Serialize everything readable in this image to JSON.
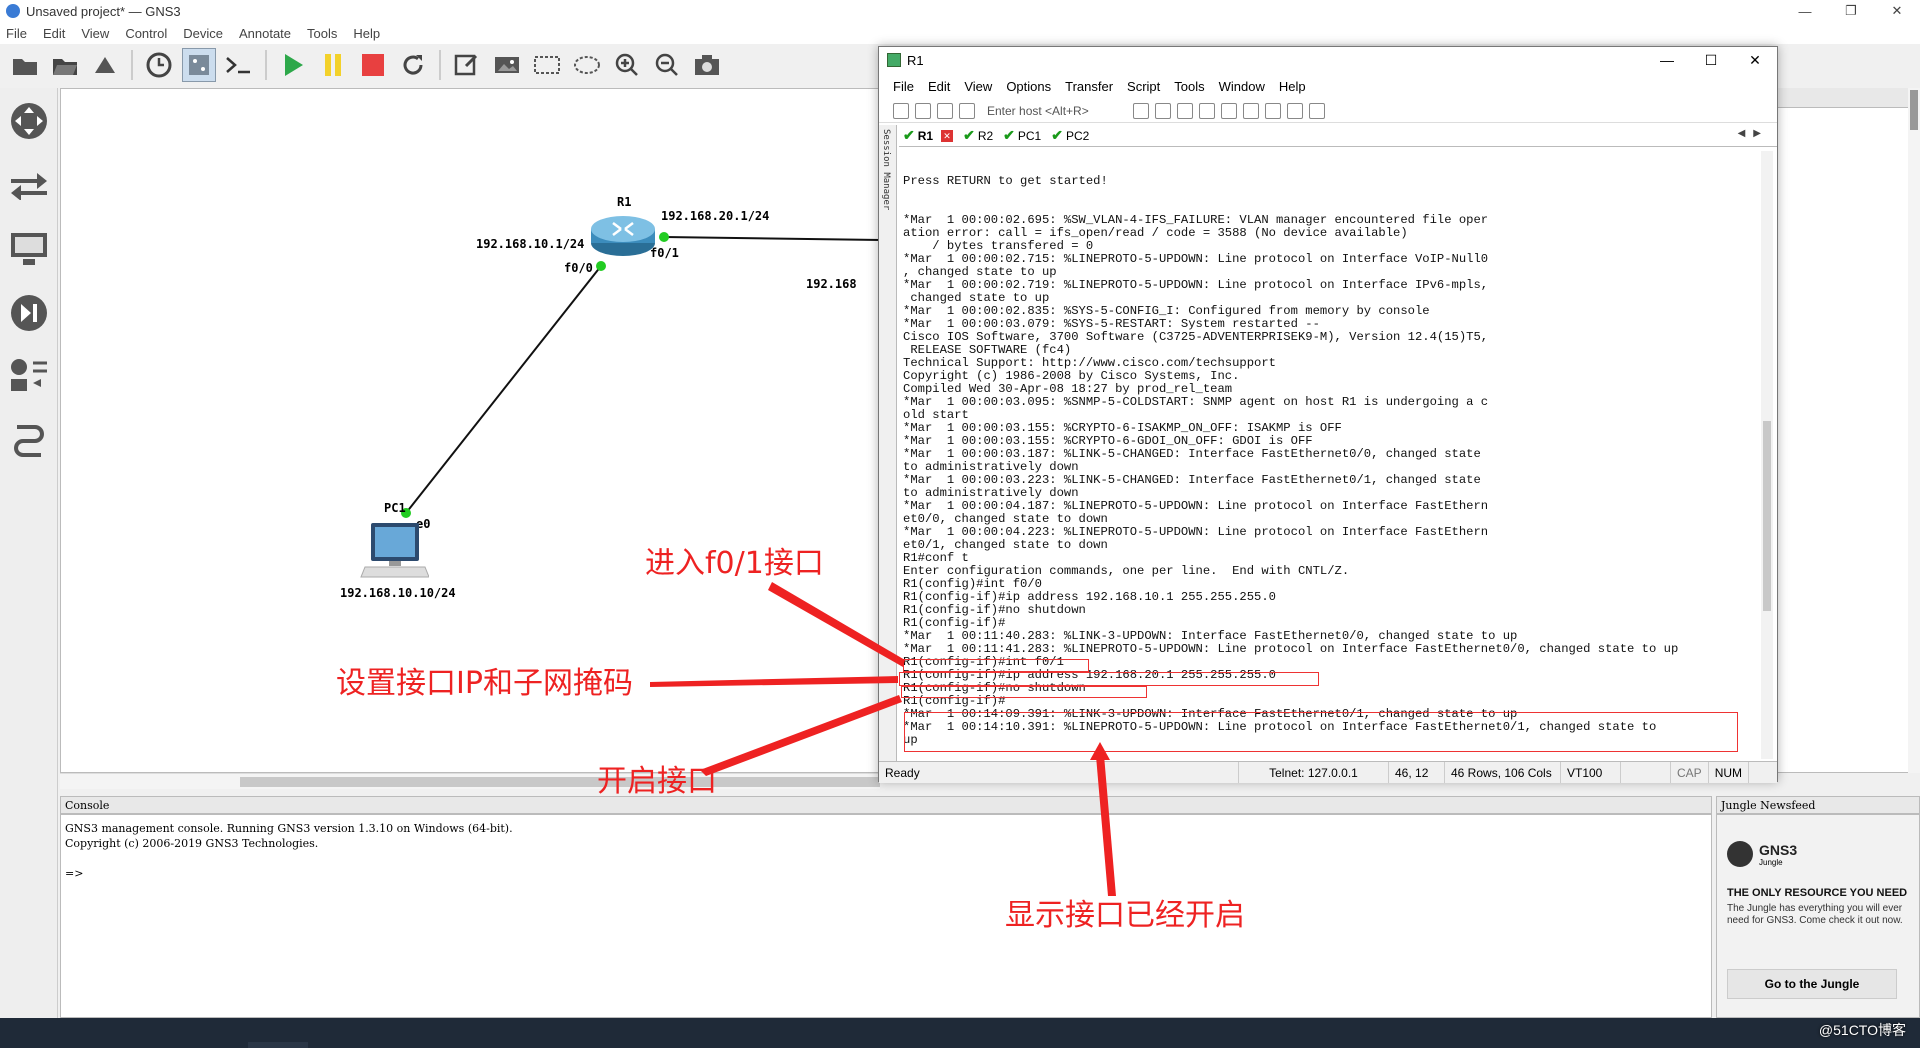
{
  "window": {
    "title": "Unsaved project* — GNS3",
    "ctrls": [
      "—",
      "❐",
      "✕"
    ]
  },
  "menu": [
    "File",
    "Edit",
    "View",
    "Control",
    "Device",
    "Annotate",
    "Tools",
    "Help"
  ],
  "topology": {
    "r1": {
      "name": "R1",
      "ip_f00": "192.168.10.1/24",
      "ip_f01": "192.168.20.1/24",
      "port_f00": "f0/0",
      "port_f01": "f0/1"
    },
    "pc1": {
      "name": "PC1",
      "port": "e0",
      "ip": "192.168.10.10/24"
    },
    "partial_ip": "192.168"
  },
  "console": {
    "title": "Console",
    "text": "GNS3 management console. Running GNS3 version 1.3.10 on Windows (64-bit).\nCopyright (c) 2006-2019 GNS3 Technologies.\n\n=>"
  },
  "newsfeed": {
    "title": "Jungle Newsfeed",
    "logo": "GNS3",
    "logo_sub": "Jungle",
    "headline": "THE ONLY RESOURCE YOU NEED",
    "text": "The Jungle has everything you will ever need for GNS3. Come check it out now.",
    "button": "Go to the Jungle"
  },
  "crt": {
    "title": "R1",
    "ctrls": [
      "—",
      "☐",
      "✕"
    ],
    "menu": [
      "File",
      "Edit",
      "View",
      "Options",
      "Transfer",
      "Script",
      "Tools",
      "Window",
      "Help"
    ],
    "host_placeholder": "Enter host <Alt+R>",
    "session_manager": "Session Manager",
    "tabs": [
      {
        "label": "R1",
        "active": true
      },
      {
        "label": "R2"
      },
      {
        "label": "PC1"
      },
      {
        "label": "PC2"
      }
    ],
    "terminal": "Press RETURN to get started!\n\n\n*Mar  1 00:00:02.695: %SW_VLAN-4-IFS_FAILURE: VLAN manager encountered file oper\nation error: call = ifs_open/read / code = 3588 (No device available)\n    / bytes transfered = 0\n*Mar  1 00:00:02.715: %LINEPROTO-5-UPDOWN: Line protocol on Interface VoIP-Null0\n, changed state to up\n*Mar  1 00:00:02.719: %LINEPROTO-5-UPDOWN: Line protocol on Interface IPv6-mpls,\n changed state to up\n*Mar  1 00:00:02.835: %SYS-5-CONFIG_I: Configured from memory by console\n*Mar  1 00:00:03.079: %SYS-5-RESTART: System restarted --\nCisco IOS Software, 3700 Software (C3725-ADVENTERPRISEK9-M), Version 12.4(15)T5,\n RELEASE SOFTWARE (fc4)\nTechnical Support: http://www.cisco.com/techsupport\nCopyright (c) 1986-2008 by Cisco Systems, Inc.\nCompiled Wed 30-Apr-08 18:27 by prod_rel_team\n*Mar  1 00:00:03.095: %SNMP-5-COLDSTART: SNMP agent on host R1 is undergoing a c\nold start\n*Mar  1 00:00:03.155: %CRYPTO-6-ISAKMP_ON_OFF: ISAKMP is OFF\n*Mar  1 00:00:03.155: %CRYPTO-6-GDOI_ON_OFF: GDOI is OFF\n*Mar  1 00:00:03.187: %LINK-5-CHANGED: Interface FastEthernet0/0, changed state\nto administratively down\n*Mar  1 00:00:03.223: %LINK-5-CHANGED: Interface FastEthernet0/1, changed state\nto administratively down\n*Mar  1 00:00:04.187: %LINEPROTO-5-UPDOWN: Line protocol on Interface FastEthern\net0/0, changed state to down\n*Mar  1 00:00:04.223: %LINEPROTO-5-UPDOWN: Line protocol on Interface FastEthern\net0/1, changed state to down\nR1#conf t\nEnter configuration commands, one per line.  End with CNTL/Z.\nR1(config)#int f0/0\nR1(config-if)#ip address 192.168.10.1 255.255.255.0\nR1(config-if)#no shutdown\nR1(config-if)#\n*Mar  1 00:11:40.283: %LINK-3-UPDOWN: Interface FastEthernet0/0, changed state to up\n*Mar  1 00:11:41.283: %LINEPROTO-5-UPDOWN: Line protocol on Interface FastEthernet0/0, changed state to up\nR1(config-if)#int f0/1\nR1(config-if)#ip address 192.168.20.1 255.255.255.0\nR1(config-if)#no shutdown\nR1(config-if)#\n*Mar  1 00:14:09.391: %LINK-3-UPDOWN: Interface FastEthernet0/1, changed state to up\n*Mar  1 00:14:10.391: %LINEPROTO-5-UPDOWN: Line protocol on Interface FastEthernet0/1, changed state to\nup",
    "status": {
      "ready": "Ready",
      "telnet": "Telnet: 127.0.0.1",
      "pos": "46,  12",
      "size": "46 Rows, 106 Cols",
      "term": "VT100",
      "cap": "CAP",
      "num": "NUM"
    }
  },
  "annotations": {
    "enter_f01": "进入f0/1接口",
    "set_ip": "设置接口IP和子网掩码",
    "enable": "开启接口",
    "shown_up": "显示接口已经开启"
  },
  "watermark": "@51CTO博客",
  "colors": {
    "annotation": "#e22222",
    "link_dot": "#22cc22",
    "tab_check": "#1a9a1a"
  }
}
